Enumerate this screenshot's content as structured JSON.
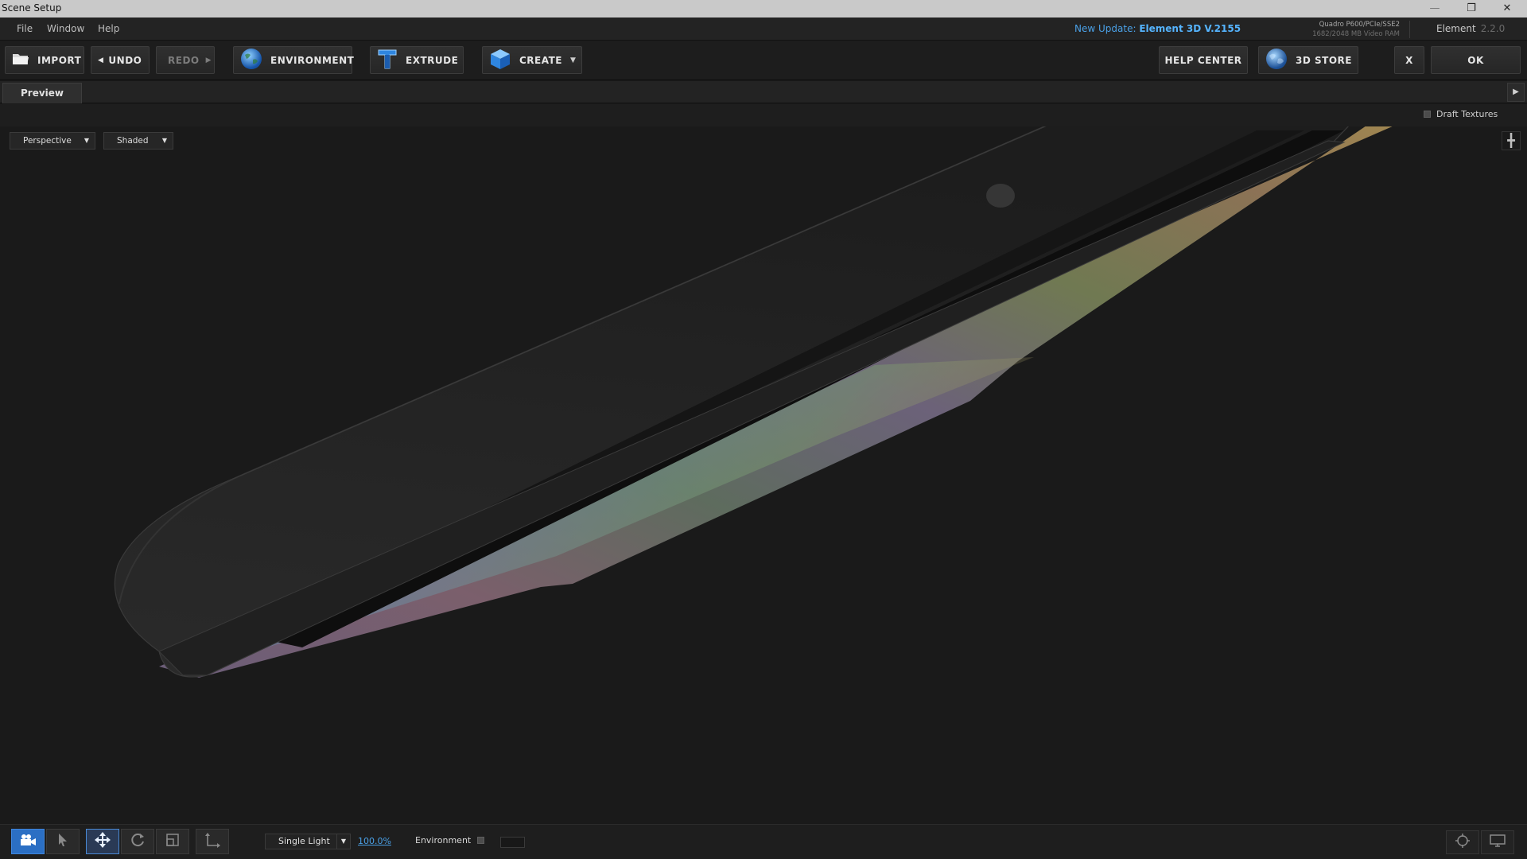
{
  "window": {
    "title": "Scene Setup",
    "minimize_icon": "minimize-icon",
    "restore_icon": "restore-icon",
    "close_icon": "close-icon"
  },
  "menu": {
    "items": [
      "File",
      "Window",
      "Help"
    ]
  },
  "status": {
    "update_prefix": "New Update:",
    "update_version": "Element 3D V.2155",
    "gpu_name": "Quadro P600/PCIe/SSE2",
    "gpu_ram": "1682/2048 MB Video RAM",
    "product_name": "Element",
    "product_version": "2.2.0"
  },
  "toolbar": {
    "import": "IMPORT",
    "undo": "UNDO",
    "redo": "REDO",
    "environment": "ENVIRONMENT",
    "extrude": "EXTRUDE",
    "create": "CREATE",
    "help_center": "HELP CENTER",
    "store": "3D STORE",
    "cancel": "X",
    "ok": "OK"
  },
  "tabs": {
    "preview": "Preview"
  },
  "options": {
    "draft_textures": "Draft Textures",
    "draft_textures_checked": false
  },
  "viewport": {
    "camera": "Perspective",
    "shading": "Shaded"
  },
  "bottom": {
    "tools": [
      "camera-icon",
      "select-arrow-icon",
      "move-icon",
      "rotate-icon",
      "scale-icon",
      "axis-icon"
    ],
    "active_tool": "move-icon",
    "light_preset": "Single Light",
    "light_intensity": "100.0%",
    "environment_label": "Environment",
    "environment_checked": false
  }
}
